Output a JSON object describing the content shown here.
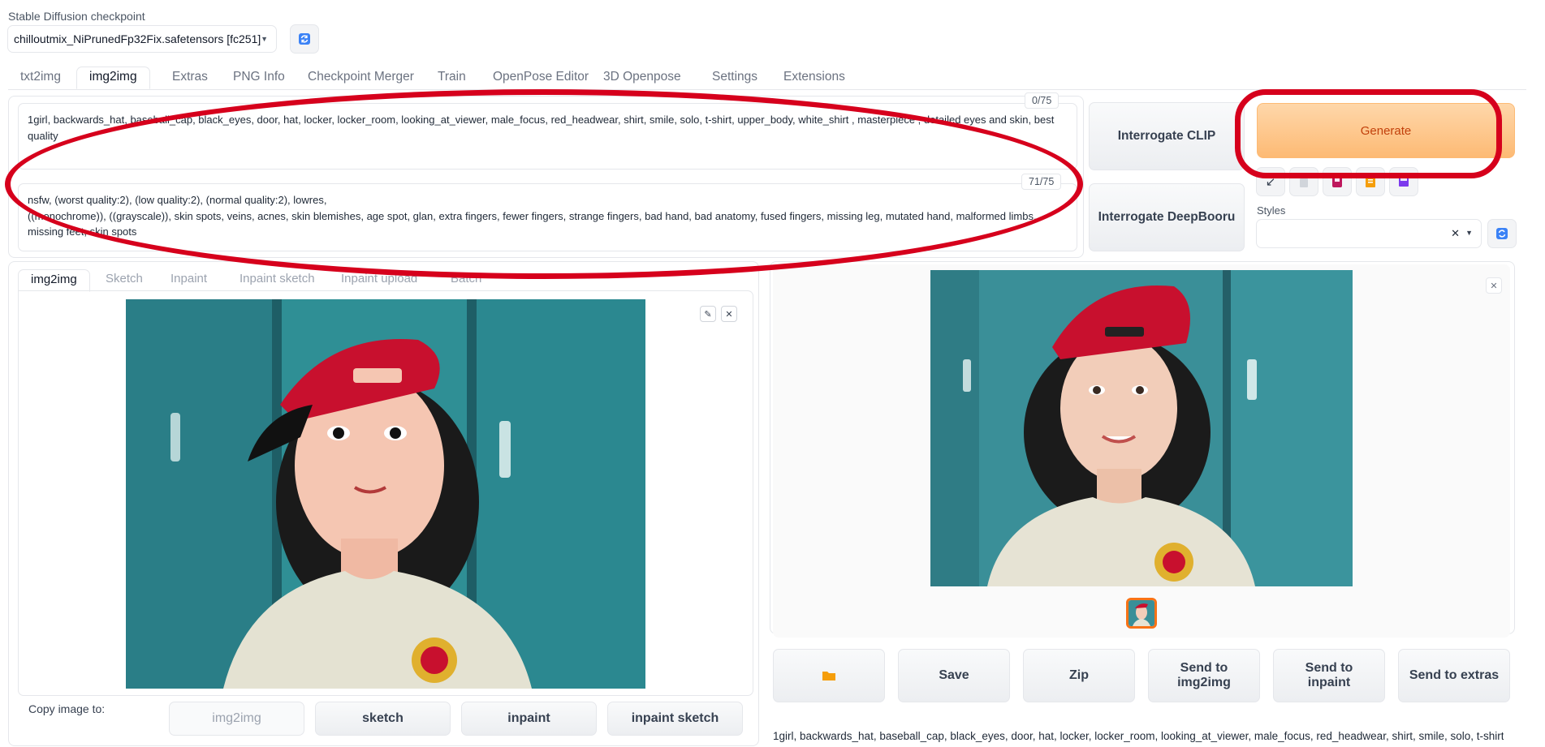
{
  "checkpoint": {
    "label": "Stable Diffusion checkpoint",
    "value": "chilloutmix_NiPrunedFp32Fix.safetensors [fc251]"
  },
  "tabs": [
    "txt2img",
    "img2img",
    "Extras",
    "PNG Info",
    "Checkpoint Merger",
    "Train",
    "OpenPose Editor",
    "3D Openpose",
    "Settings",
    "Extensions"
  ],
  "active_tab": "img2img",
  "prompt": {
    "text": "1girl, backwards_hat, baseball_cap, black_eyes, door, hat, locker, locker_room, looking_at_viewer, male_focus, red_headwear, shirt, smile, solo, t-shirt, upper_body, white_shirt , masterpiece , detailed eyes and skin, best quality",
    "token_count": "0/75"
  },
  "negative_prompt": {
    "text": "nsfw, (worst quality:2), (low quality:2), (normal quality:2), lowres,\n((monochrome)), ((grayscale)), skin spots, veins, acnes, skin blemishes, age spot, glan, extra fingers, fewer fingers, strange fingers, bad hand, bad anatomy, fused fingers, missing leg, mutated hand, malformed limbs, missing feet, skin spots",
    "token_count": "71/75"
  },
  "interrogate": {
    "clip": "Interrogate CLIP",
    "deepbooru": "Interrogate DeepBooru"
  },
  "generate_label": "Generate",
  "styles_label": "Styles",
  "input_tabs": [
    "img2img",
    "Sketch",
    "Inpaint",
    "Inpaint sketch",
    "Inpaint upload",
    "Batch"
  ],
  "copy_to": {
    "label": "Copy image to:",
    "buttons": [
      "img2img",
      "sketch",
      "inpaint",
      "inpaint sketch"
    ]
  },
  "output_actions": [
    "Save",
    "Zip",
    "Send to img2img",
    "Send to inpaint",
    "Send to extras"
  ],
  "output_caption": "1girl, backwards_hat, baseball_cap, black_eyes, door, hat, locker, locker_room, looking_at_viewer, male_focus, red_headwear, shirt, smile, solo, t-shirt,",
  "colors": {
    "accent_orange": "#fdba74",
    "annotation_red": "#d6001c",
    "refresh_blue": "#3b82f6"
  }
}
